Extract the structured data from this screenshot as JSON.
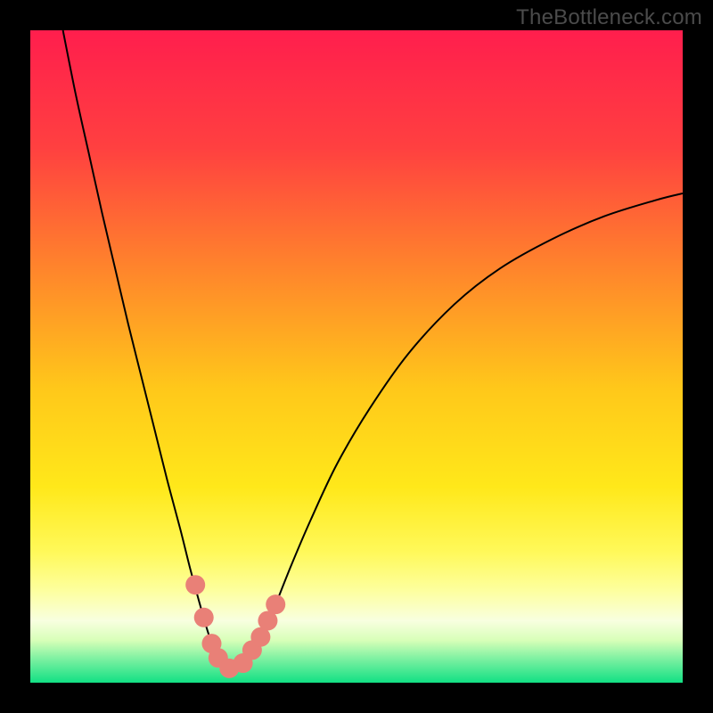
{
  "watermark": "TheBottleneck.com",
  "chart_data": {
    "type": "line",
    "title": "",
    "xlabel": "",
    "ylabel": "",
    "xlim": [
      0,
      100
    ],
    "ylim": [
      0,
      100
    ],
    "grid": false,
    "legend": false,
    "annotations": [],
    "background_gradient": {
      "type": "vertical-rainbow",
      "stops": [
        {
          "offset": 0.0,
          "color": "#ff1e4d"
        },
        {
          "offset": 0.18,
          "color": "#ff4040"
        },
        {
          "offset": 0.38,
          "color": "#ff8a2a"
        },
        {
          "offset": 0.55,
          "color": "#ffc81a"
        },
        {
          "offset": 0.7,
          "color": "#ffe81a"
        },
        {
          "offset": 0.8,
          "color": "#fff95a"
        },
        {
          "offset": 0.86,
          "color": "#fdffa0"
        },
        {
          "offset": 0.905,
          "color": "#f8ffe0"
        },
        {
          "offset": 0.935,
          "color": "#d8ffb8"
        },
        {
          "offset": 0.965,
          "color": "#78f0a0"
        },
        {
          "offset": 1.0,
          "color": "#12e084"
        }
      ]
    },
    "series": [
      {
        "name": "bottleneck-curve",
        "color": "#000000",
        "x": [
          5.0,
          7.0,
          9.0,
          11.0,
          13.0,
          15.0,
          17.0,
          19.0,
          21.0,
          23.0,
          24.5,
          26.0,
          27.0,
          28.0,
          29.0,
          30.0,
          31.0,
          32.0,
          33.5,
          35.0,
          37.0,
          40.0,
          43.0,
          47.0,
          52.0,
          58.0,
          65.0,
          72.0,
          80.0,
          88.0,
          96.0,
          100.0
        ],
        "values": [
          100.0,
          90.0,
          81.0,
          72.0,
          63.5,
          55.0,
          47.0,
          39.0,
          31.0,
          23.5,
          17.5,
          12.0,
          8.5,
          5.5,
          3.5,
          2.3,
          2.0,
          2.3,
          3.5,
          6.0,
          10.5,
          18.0,
          25.0,
          33.5,
          42.0,
          50.5,
          58.0,
          63.5,
          68.0,
          71.5,
          74.0,
          75.0
        ]
      }
    ],
    "markers": {
      "name": "highlight-dots",
      "color": "#e98077",
      "size": 11,
      "points": [
        {
          "x": 25.3,
          "y": 15.0
        },
        {
          "x": 26.6,
          "y": 10.0
        },
        {
          "x": 27.8,
          "y": 6.0
        },
        {
          "x": 28.8,
          "y": 3.8
        },
        {
          "x": 30.5,
          "y": 2.2
        },
        {
          "x": 32.6,
          "y": 3.0
        },
        {
          "x": 34.0,
          "y": 5.0
        },
        {
          "x": 35.3,
          "y": 7.0
        },
        {
          "x": 36.4,
          "y": 9.5
        },
        {
          "x": 37.6,
          "y": 12.0
        }
      ]
    }
  }
}
